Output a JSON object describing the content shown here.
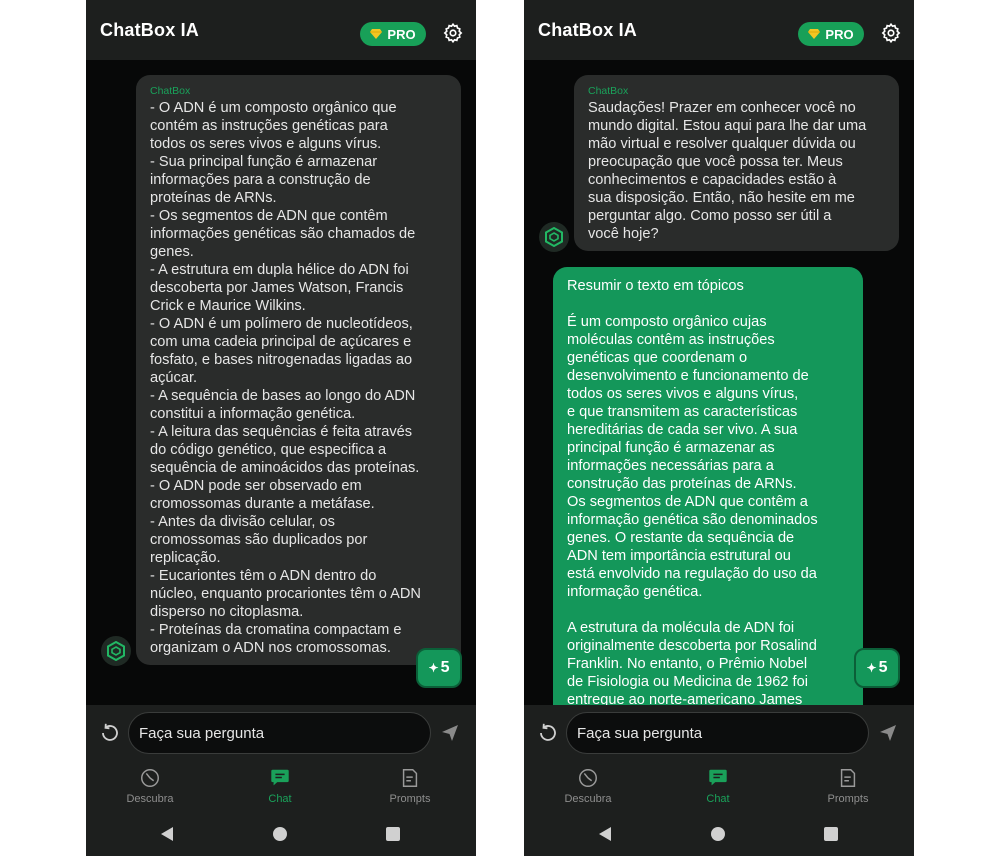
{
  "app": {
    "title": "ChatBox IA",
    "pro_label": "PRO",
    "accent_color": "#18a058"
  },
  "left_screen": {
    "messages": [
      {
        "role": "bot",
        "sender": "ChatBox",
        "text": "- O ADN é um composto orgânico que\ncontém as instruções genéticas para\ntodos os seres vivos e alguns vírus.\n- Sua principal função é armazenar\ninformações para a construção de\nproteínas de ARNs.\n- Os segmentos de ADN que contêm\ninformações genéticas são chamados de\ngenes.\n- A estrutura em dupla hélice do ADN foi\ndescoberta por James Watson, Francis\nCrick e Maurice Wilkins.\n- O ADN é um polímero de nucleotídeos,\ncom uma cadeia principal de açúcares e\nfosfato, e bases nitrogenadas ligadas ao\naçúcar.\n- A sequência de bases ao longo do ADN\nconstitui a informação genética.\n- A leitura das sequências é feita através\ndo código genético, que especifica a\nsequência de aminoácidos das proteínas.\n- O ADN pode ser observado em\ncromossomas durante a metáfase.\n- Antes da divisão celular, os\ncromossomas são duplicados por\nreplicação.\n- Eucariontes têm o ADN dentro do\nnúcleo, enquanto procariontes têm o ADN\ndisperso no citoplasma.\n- Proteínas da cromatina compactam e\norganizam o ADN nos cromossomas."
      }
    ],
    "credits_label": "5"
  },
  "right_screen": {
    "messages": [
      {
        "role": "bot",
        "sender": "ChatBox",
        "text": "Saudações! Prazer em conhecer você no\nmundo digital. Estou aqui para lhe dar uma\nmão virtual e resolver qualquer dúvida ou\npreocupação que você possa ter. Meus\nconhecimentos e capacidades estão à\nsua disposição. Então, não hesite em me\nperguntar algo. Como posso ser útil a\nvocê hoje?"
      },
      {
        "role": "user",
        "text": "Resumir o texto em tópicos\n\nÉ um composto orgânico cujas\nmoléculas contêm as instruções\ngenéticas que coordenam o\ndesenvolvimento e funcionamento de\ntodos os seres vivos e alguns vírus,\ne que transmitem as características\nhereditárias de cada ser vivo. A sua\nprincipal função é armazenar as\ninformações necessárias para a\nconstrução das proteínas de ARNs.\nOs segmentos de ADN que contêm a\ninformação genética são denominados\ngenes. O restante da sequência de\nADN tem importância estrutural ou\nestá envolvido na regulação do uso da\ninformação genética.\n\nA estrutura da molécula de ADN foi\noriginalmente descoberta por Rosalind\nFranklin. No entanto, o Prêmio Nobel\nde Fisiologia ou Medicina de 1962 foi\nentregue ao norte-americano James"
      }
    ],
    "credits_label": "5"
  },
  "input": {
    "placeholder": "Faça sua pergunta"
  },
  "nav": {
    "items": [
      {
        "label": "Descubra",
        "icon": "discover-icon",
        "active": false
      },
      {
        "label": "Chat",
        "icon": "chat-icon",
        "active": true
      },
      {
        "label": "Prompts",
        "icon": "prompts-icon",
        "active": false
      }
    ]
  }
}
